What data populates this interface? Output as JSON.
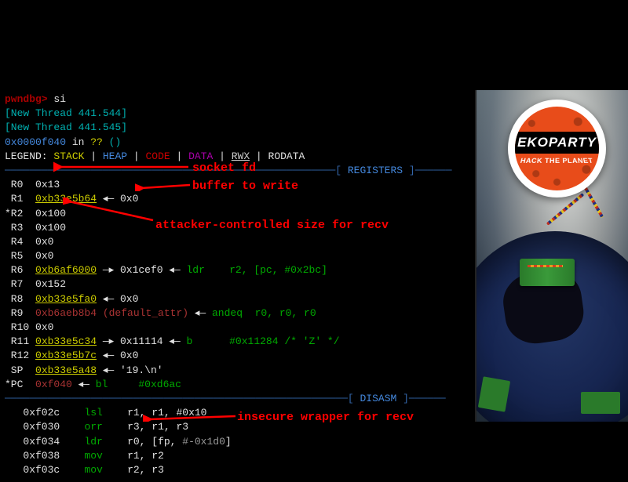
{
  "prompt": "pwndbg>",
  "cmd": "si",
  "threads": [
    "[New Thread 441.544]",
    "[New Thread 441.545]"
  ],
  "loc_addr": "0x0000f040",
  "loc_mid": " in ",
  "loc_q": "??",
  "loc_paren": " ()",
  "legend_label": "LEGEND: ",
  "legend": {
    "stack": "STACK",
    "heap": "HEAP",
    "code": "CODE",
    "data": "DATA",
    "rwx": "RWX",
    "rodata": "RODATA"
  },
  "sep_sep": " | ",
  "section_reg_pre": "──────────────────────────────────────────────────────[ ",
  "section_reg": "REGISTERS",
  "section_reg_post": " ]──────",
  "registers": [
    {
      "n": " R0  ",
      "v": "0x13",
      "cls": "white"
    },
    {
      "n": " R1  ",
      "v": "0xb33e5b64",
      "cls": "yellow",
      "rest": " ◂— 0x0"
    },
    {
      "n": "*R2  ",
      "v": "0x100",
      "cls": "white"
    },
    {
      "n": " R3  ",
      "v": "0x100",
      "cls": "white"
    },
    {
      "n": " R4  ",
      "v": "0x0",
      "cls": "white"
    },
    {
      "n": " R5  ",
      "v": "0x0",
      "cls": "white"
    },
    {
      "n": " R6  ",
      "v": "0xb6af6000",
      "cls": "yellow",
      "rest": " —▸ 0x1cef0 ◂— ",
      "instr": "ldr    r2, [pc, #0x2bc]"
    },
    {
      "n": " R7  ",
      "v": "0x152",
      "cls": "white"
    },
    {
      "n": " R8  ",
      "v": "0xb33e5fa0",
      "cls": "yellow",
      "rest": " ◂— 0x0"
    },
    {
      "n": " R9  ",
      "v": "0xb6aeb8b4 (default_attr)",
      "cls": "darkred",
      "rest": " ◂— ",
      "instr": "andeq  r0, r0, r0"
    },
    {
      "n": " R10 ",
      "v": "0x0",
      "cls": "white"
    },
    {
      "n": " R11 ",
      "v": "0xb33e5c34",
      "cls": "yellow",
      "rest": " —▸ 0x11114 ◂— ",
      "instr": "b      #0x11284 /* 'Z' */"
    },
    {
      "n": " R12 ",
      "v": "0xb33e5b7c",
      "cls": "yellow",
      "rest": " ◂— 0x0"
    },
    {
      "n": " SP  ",
      "v": "0xb33e5a48",
      "cls": "yellow",
      "rest": " ◂— '19.\\n'"
    },
    {
      "n": "*PC  ",
      "v": "0xf040",
      "cls": "darkred",
      "rest": " ◂— ",
      "instr": "bl     #0xd6ac"
    }
  ],
  "section_dis_pre": "────────────────────────────────────────────────────────[ ",
  "section_dis": "DISASM",
  "section_dis_post": " ]──────",
  "disasm": [
    {
      "a": "   0xf02c",
      "op": "lsl",
      "args": "r1, r1, #0x10"
    },
    {
      "a": "   0xf030",
      "op": "orr",
      "args": "r3, r1, r3"
    },
    {
      "a": "   0xf034",
      "op": "ldr",
      "args": "r0, [fp, ",
      "extra": "#-0x1d0",
      "extra2": "]"
    },
    {
      "a": "   0xf038",
      "op": "mov",
      "args": "r1, r2"
    },
    {
      "a": "   0xf03c",
      "op": "mov",
      "args": "r2, r3"
    }
  ],
  "annotations": {
    "socket": "socket fd",
    "buffer": "buffer to write",
    "attacker": "attacker-controlled size for recv",
    "insecure": "insecure wrapper for recv"
  },
  "logo": {
    "title": "EKOPARTY",
    "sub": "HACK THE PLANET"
  }
}
